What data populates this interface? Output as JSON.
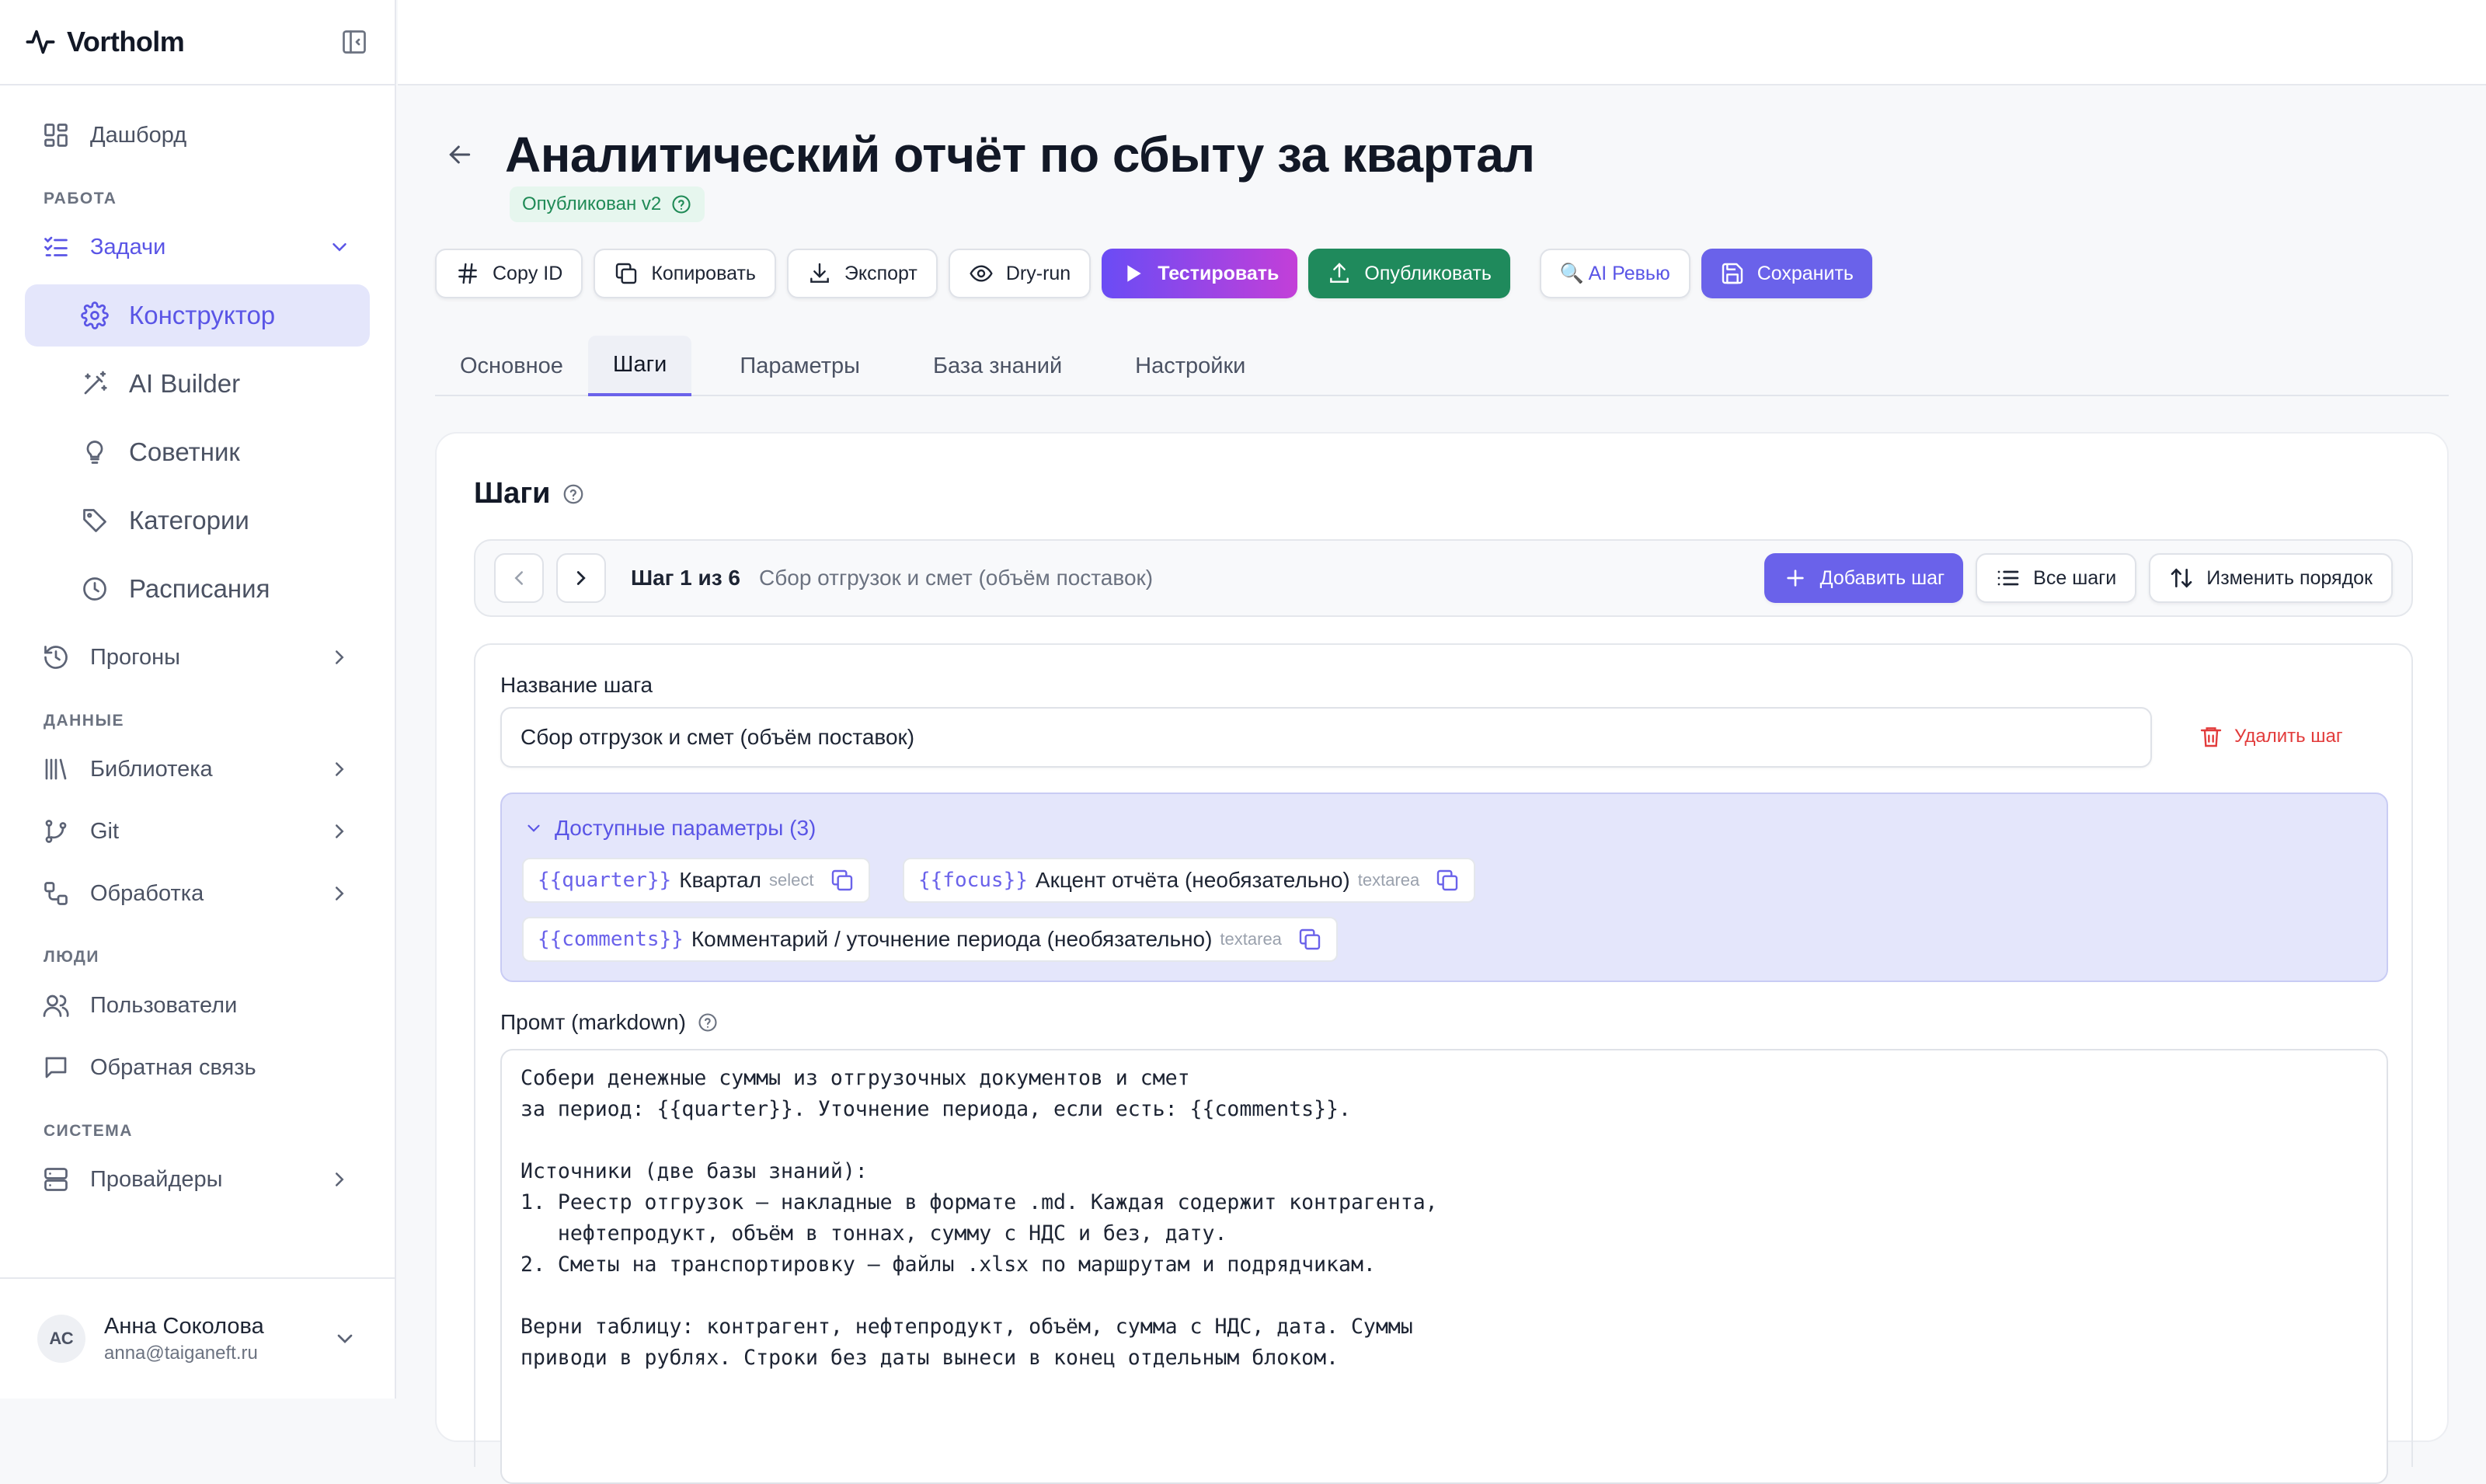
{
  "app": {
    "name": "Vortholm"
  },
  "sidebar": {
    "items": [
      {
        "label": "Дашборд"
      },
      {
        "section": "РАБОТА"
      },
      {
        "label": "Задачи"
      },
      {
        "label": "Конструктор"
      },
      {
        "label": "AI Builder"
      },
      {
        "label": "Советник"
      },
      {
        "label": "Категории"
      },
      {
        "label": "Расписания"
      },
      {
        "label": "Прогоны"
      },
      {
        "section": "ДАННЫЕ"
      },
      {
        "label": "Библиотека"
      },
      {
        "label": "Git"
      },
      {
        "label": "Обработка"
      },
      {
        "section": "ЛЮДИ"
      },
      {
        "label": "Пользователи"
      },
      {
        "label": "Обратная связь"
      },
      {
        "section": "СИСТЕМА"
      },
      {
        "label": "Провайдеры"
      }
    ],
    "user": {
      "initials": "АС",
      "name": "Анна Соколова",
      "email": "anna@taiganeft.ru"
    }
  },
  "page": {
    "title": "Аналитический отчёт по сбыту за квартал",
    "status": "Опубликован v2"
  },
  "toolbar": {
    "copy_id": "Copy ID",
    "copy": "Копировать",
    "export": "Экспорт",
    "dry_run": "Dry-run",
    "test": "Тестировать",
    "publish": "Опубликовать",
    "ai_review": "🔍 AI Ревью",
    "save": "Сохранить"
  },
  "tabs": [
    "Основное",
    "Шаги",
    "Параметры",
    "База знаний",
    "Настройки"
  ],
  "steps": {
    "title": "Шаги",
    "counter": "Шаг 1 из 6",
    "current_name": "Сбор отгрузок и смет (объём поставок)",
    "add": "Добавить шаг",
    "all": "Все шаги",
    "reorder": "Изменить порядок"
  },
  "step_form": {
    "name_label": "Название шага",
    "name_value": "Сбор отгрузок и смет (объём поставок)",
    "delete": "Удалить шаг",
    "params_header": "Доступные параметры (3)",
    "params": [
      {
        "code": "{{quarter}}",
        "desc": "Квартал",
        "type": "select"
      },
      {
        "code": "{{focus}}",
        "desc": "Акцент отчёта (необязательно)",
        "type": "textarea"
      },
      {
        "code": "{{comments}}",
        "desc": "Комментарий / уточнение периода (необязательно)",
        "type": "textarea"
      }
    ],
    "prompt_label": "Промт (markdown)",
    "prompt_text": "Собери денежные суммы из отгрузочных документов и смет\nза период: {{quarter}}. Уточнение периода, если есть: {{comments}}.\n\nИсточники (две базы знаний):\n1. Реестр отгрузок — накладные в формате .md. Каждая содержит контрагента,\n   нефтепродукт, объём в тоннах, сумму с НДС и без, дату.\n2. Сметы на транспортировку — файлы .xlsx по маршрутам и подрядчикам.\n\nВерни таблицу: контрагент, нефтепродукт, объём, сумма с НДС, дата. Суммы\nприводи в рублях. Строки без даты вынеси в конец отдельным блоком."
  },
  "colors": {
    "accent": "#6a62ea",
    "success": "#1f8a5c",
    "danger": "#e23b3b",
    "active_bg": "#e4e6fb"
  }
}
